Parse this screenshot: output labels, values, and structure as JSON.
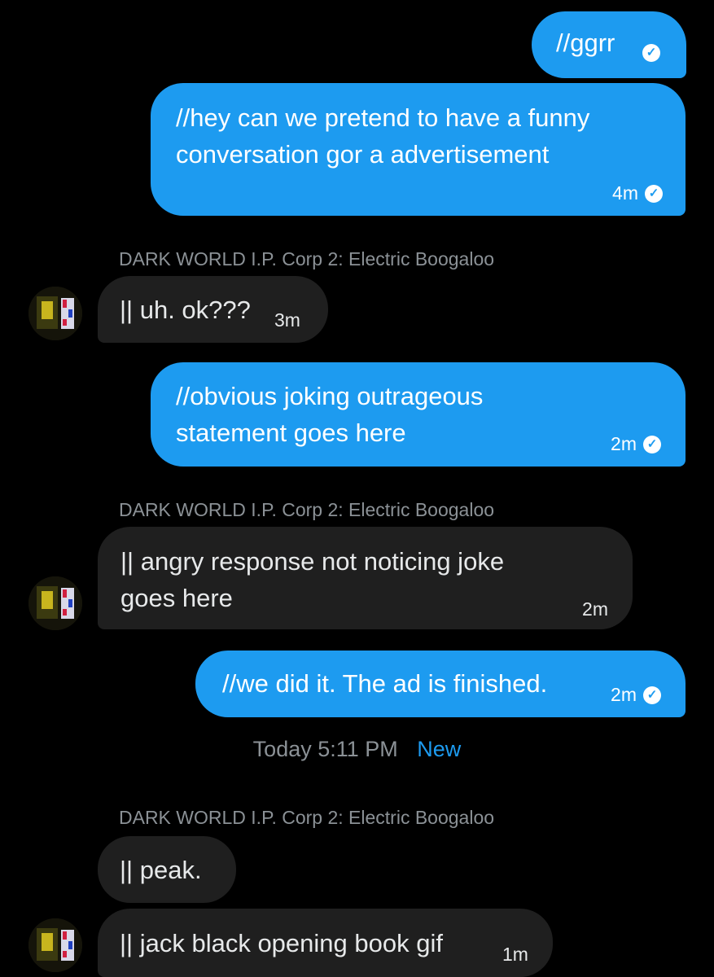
{
  "conversation": {
    "sender_name": "DARK WORLD I.P. Corp 2: Electric Boogaloo",
    "divider": {
      "time": "Today 5:11 PM",
      "new_label": "New"
    },
    "messages": {
      "m1": {
        "text": "//ggrr",
        "time": "",
        "status": "sent"
      },
      "m2": {
        "text_line1": "//hey can we pretend to have a funny",
        "text_line2": "conversation gor a advertisement",
        "time": "4m",
        "status": "sent"
      },
      "m3": {
        "text": "|| uh. ok???",
        "time": "3m"
      },
      "m4": {
        "text_line1": "//obvious joking outrageous",
        "text_line2": "statement goes here",
        "time": "2m",
        "status": "sent"
      },
      "m5": {
        "text_line1": "|| angry response not noticing joke",
        "text_line2": "goes here",
        "time": "2m"
      },
      "m6": {
        "text": "//we did it. The ad is finished.",
        "time": "2m",
        "status": "sent"
      },
      "m7": {
        "text": "|| peak.",
        "time": ""
      },
      "m8": {
        "text": "|| jack black opening book gif",
        "time": "1m"
      }
    }
  },
  "colors": {
    "outgoing_bubble": "#1d9bf0",
    "incoming_bubble": "#1f1f1f",
    "background": "#000000",
    "secondary_text": "#8b9196"
  },
  "icons": {
    "read_receipt": "check-circle-icon"
  }
}
